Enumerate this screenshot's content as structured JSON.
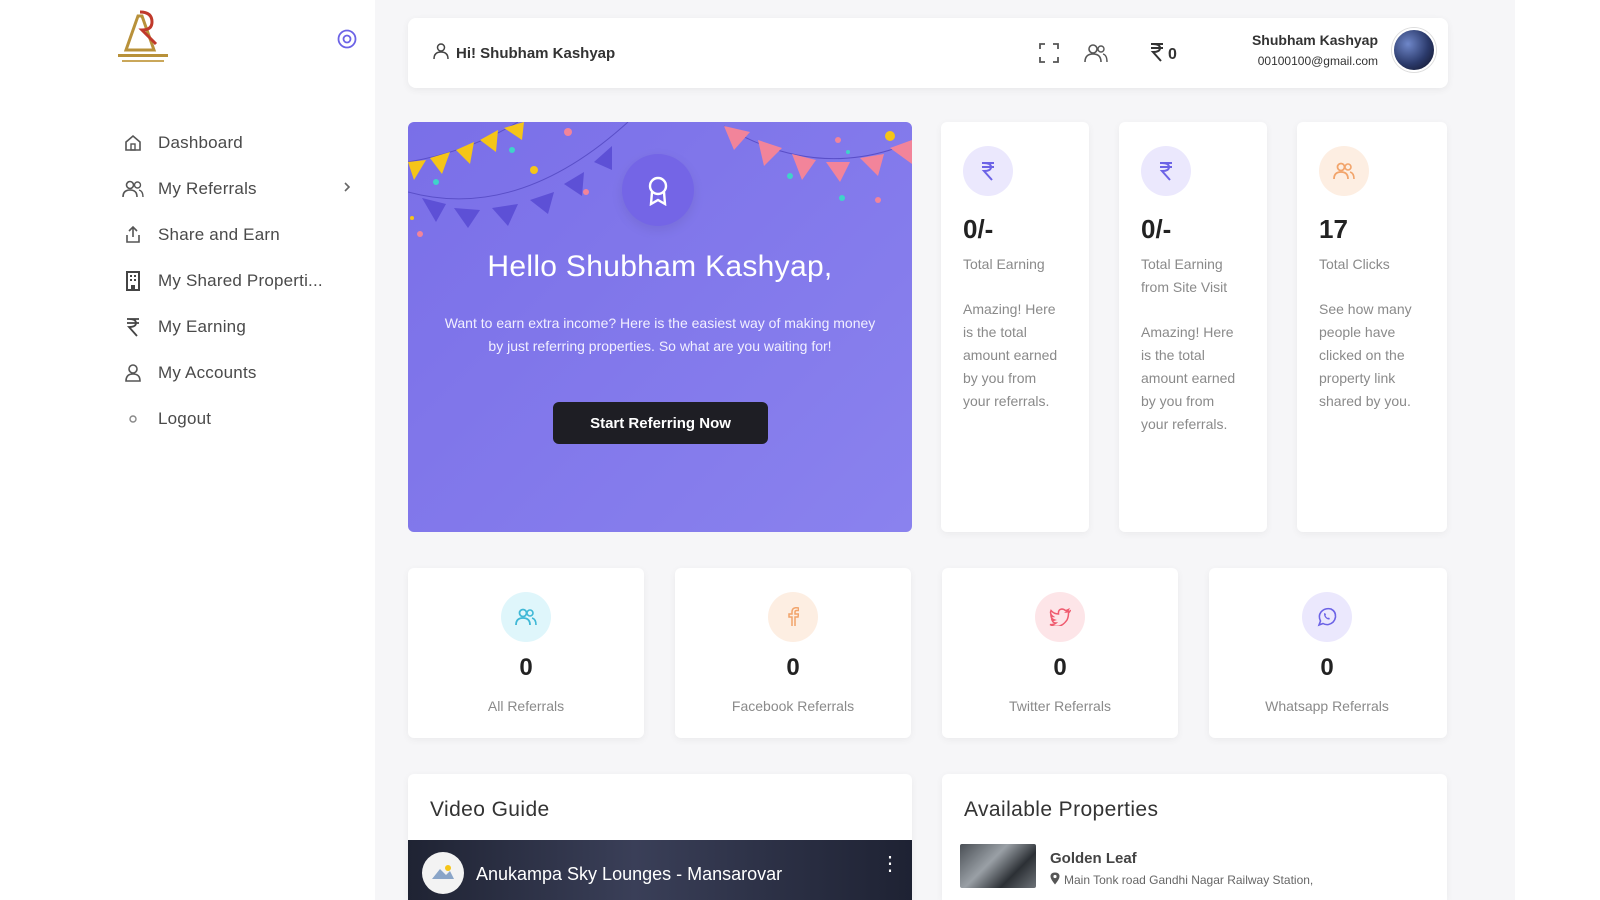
{
  "sidebar": {
    "items": [
      {
        "label": "Dashboard",
        "icon": "home-icon"
      },
      {
        "label": "My Referrals",
        "icon": "users-icon"
      },
      {
        "label": "Share and Earn",
        "icon": "share-icon"
      },
      {
        "label": "My Shared Properti...",
        "icon": "building-icon"
      },
      {
        "label": "My Earning",
        "icon": "rupee-icon"
      },
      {
        "label": "My Accounts",
        "icon": "user-icon"
      },
      {
        "label": "Logout",
        "icon": "logout-icon"
      }
    ]
  },
  "header": {
    "greeting": "Hi! Shubham Kashyap",
    "wallet": "0",
    "user_name": "Shubham Kashyap",
    "user_email": "00100100@gmail.com"
  },
  "hero": {
    "title": "Hello Shubham Kashyap,",
    "text": "Want to earn extra income? Here is the easiest way of making money by just referring properties. So what are you waiting for!",
    "cta": "Start Referring Now"
  },
  "stats": [
    {
      "value": "0/-",
      "title": "Total Earning",
      "desc": "Amazing! Here is the total amount earned by you from your referrals."
    },
    {
      "value": "0/-",
      "title": "Total Earning from Site Visit",
      "desc": "Amazing! Here is the total amount earned by you from your referrals."
    },
    {
      "value": "17",
      "title": "Total Clicks",
      "desc": "See how many people have clicked on the property link shared by you."
    }
  ],
  "referrals": [
    {
      "count": "0",
      "label": "All Referrals"
    },
    {
      "count": "0",
      "label": "Facebook Referrals"
    },
    {
      "count": "0",
      "label": "Twitter Referrals"
    },
    {
      "count": "0",
      "label": "Whatsapp Referrals"
    }
  ],
  "video_guide": {
    "title": "Video Guide",
    "video_title": "Anukampa Sky Lounges - Mansarovar"
  },
  "properties": {
    "title": "Available Properties",
    "items": [
      {
        "name": "Golden Leaf",
        "address": "Main Tonk road Gandhi Nagar Railway Station,"
      }
    ]
  },
  "colors": {
    "accent": "#7a6fe8",
    "logo_gold": "#b8913a",
    "logo_red": "#c0392b"
  }
}
